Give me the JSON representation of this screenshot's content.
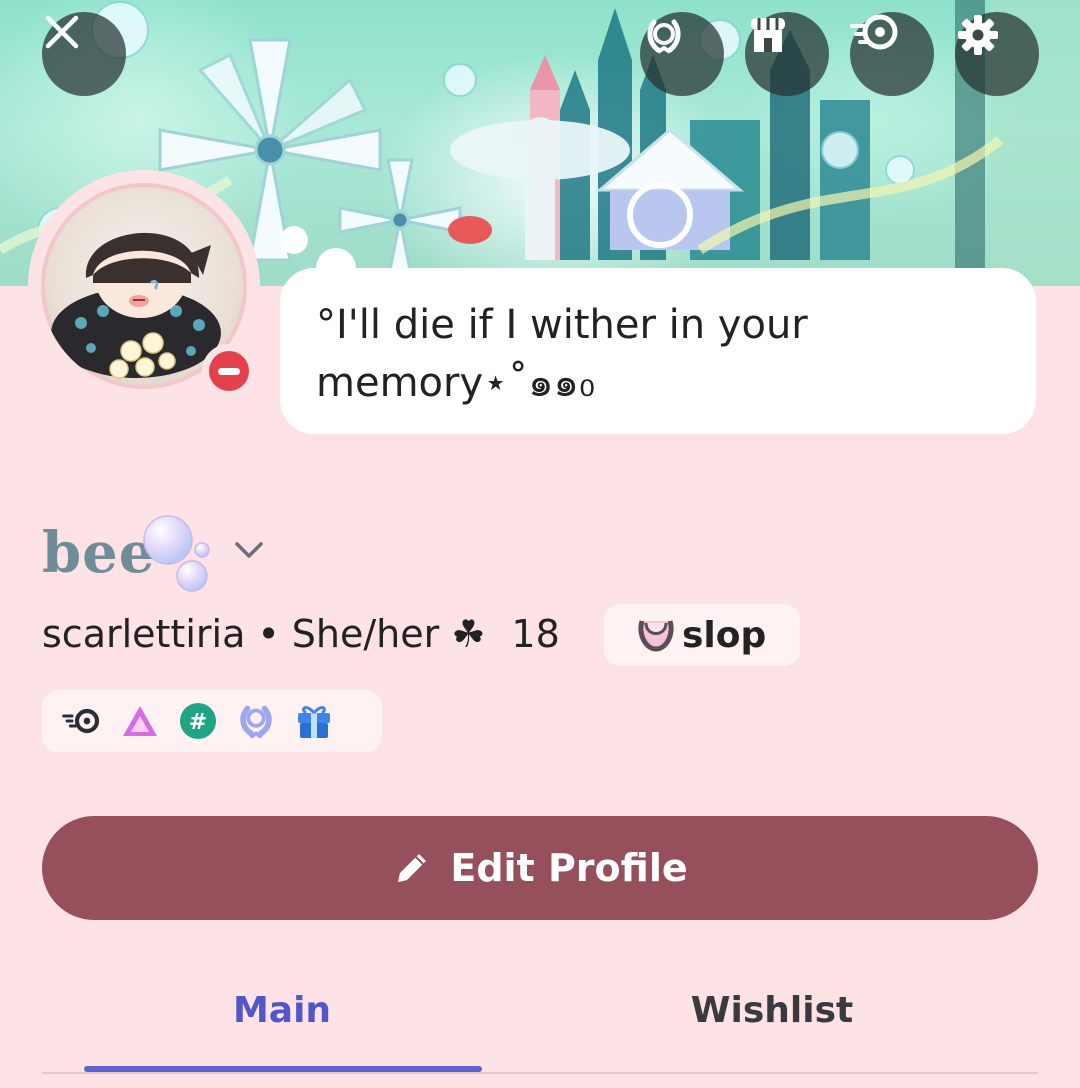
{
  "banner": {
    "close_icon": "close-icon",
    "actions": [
      {
        "name": "nitro-laurel-icon"
      },
      {
        "name": "shop-icon"
      },
      {
        "name": "nitro-icon"
      },
      {
        "name": "gear-icon"
      }
    ]
  },
  "profile": {
    "status": "do-not-disturb",
    "custom_status": "°I'll die if I wither in your memory⋆˚๑๑₀",
    "display_name": "bee",
    "username": "scarlettiria",
    "separator": "•",
    "pronouns": "She/her ☘",
    "age": "18",
    "clan_tag": "slop",
    "badges": [
      "nitro-boost-icon",
      "hypesquad-triangle-icon",
      "hashtag-icon",
      "laurel-icon",
      "gift-icon"
    ]
  },
  "actions": {
    "edit_profile_label": "Edit Profile"
  },
  "tabs": [
    {
      "label": "Main",
      "active": true
    },
    {
      "label": "Wishlist",
      "active": false
    }
  ],
  "colors": {
    "background": "#fde2e6",
    "accent": "#96505b",
    "tab_active": "#5257c8",
    "dnd": "#e3414b"
  }
}
